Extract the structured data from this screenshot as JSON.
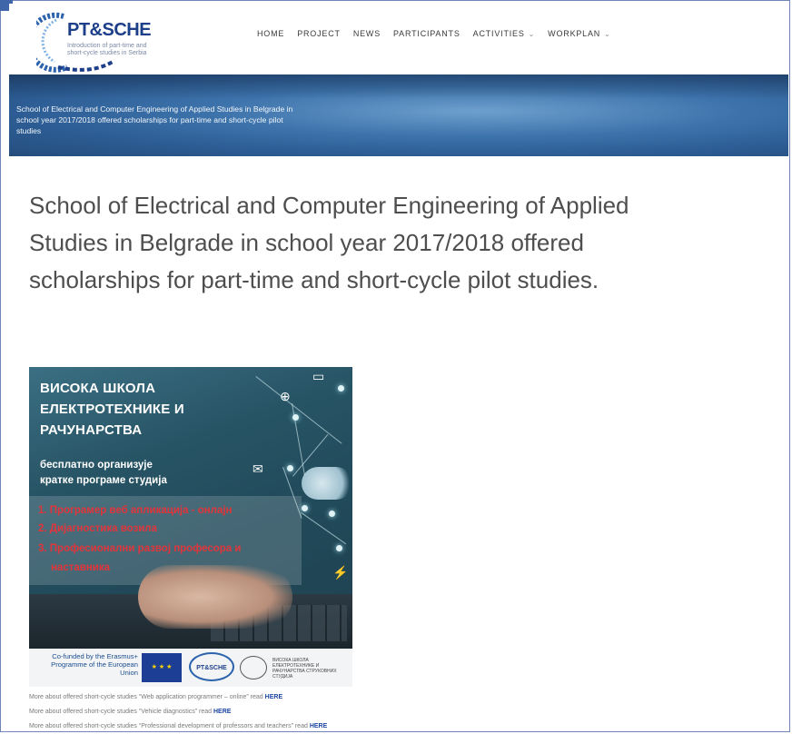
{
  "header": {
    "logo": {
      "title": "PT&SCHE",
      "subtitle": "Introduction of part-time and short-cycle studies in Serbia"
    },
    "nav": [
      {
        "label": "HOME",
        "has_caret": false
      },
      {
        "label": "PROJECT",
        "has_caret": false
      },
      {
        "label": "NEWS",
        "has_caret": false
      },
      {
        "label": "PARTICIPANTS",
        "has_caret": false
      },
      {
        "label": "ACTIVITIES",
        "has_caret": true
      },
      {
        "label": "WORKPLAN",
        "has_caret": true
      }
    ],
    "caret_glyph": "⌄"
  },
  "banner": {
    "text": "School of Electrical and Computer Engineering of Applied Studies in Belgrade in school year 2017/2018 offered scholarships for part-time and short-cycle pilot studies"
  },
  "article": {
    "heading": "School of Electrical and Computer Engineering of Applied Studies in Belgrade in school year 2017/2018 offered scholarships for part-time and short-cycle pilot studies."
  },
  "poster": {
    "title_lines": [
      "ВИСОКА ШКОЛА",
      "ЕЛЕКТРОТЕХНИКЕ И",
      "РАЧУНАРСТВА"
    ],
    "subtitle_lines": [
      "бесплатно организује",
      "кратке програме студија"
    ],
    "items": [
      "1. Програмер веб апликација - онлајн",
      "2. Дијагностика возила",
      "3. Професионални развој професора и",
      "наставника"
    ],
    "footer": {
      "cofund": "Co-funded by the Erasmus+ Programme of the European Union",
      "eu_flag": "★ ★ ★",
      "partner_logo": "PT&SCHE",
      "school_text": "ВИСОКА ШКОЛА ЕЛЕКТРОТЕХНИКЕ И РАЧУНАРСТВА СТРУКОВНИХ СТУДИЈА"
    }
  },
  "links": [
    {
      "prefix": "More about offered short-cycle studies “Web application programmer – online” read",
      "link": "HERE"
    },
    {
      "prefix": "More about offered short-cycle studies “Vehicle diagnostics” read",
      "link": "HERE"
    },
    {
      "prefix": "More about offered short-cycle studies “Professional development of professors and teachers” read",
      "link": "HERE"
    }
  ],
  "colors": {
    "brand_blue": "#1d3f8a",
    "link": "#1c47a3",
    "poster_red": "#e2353b"
  }
}
